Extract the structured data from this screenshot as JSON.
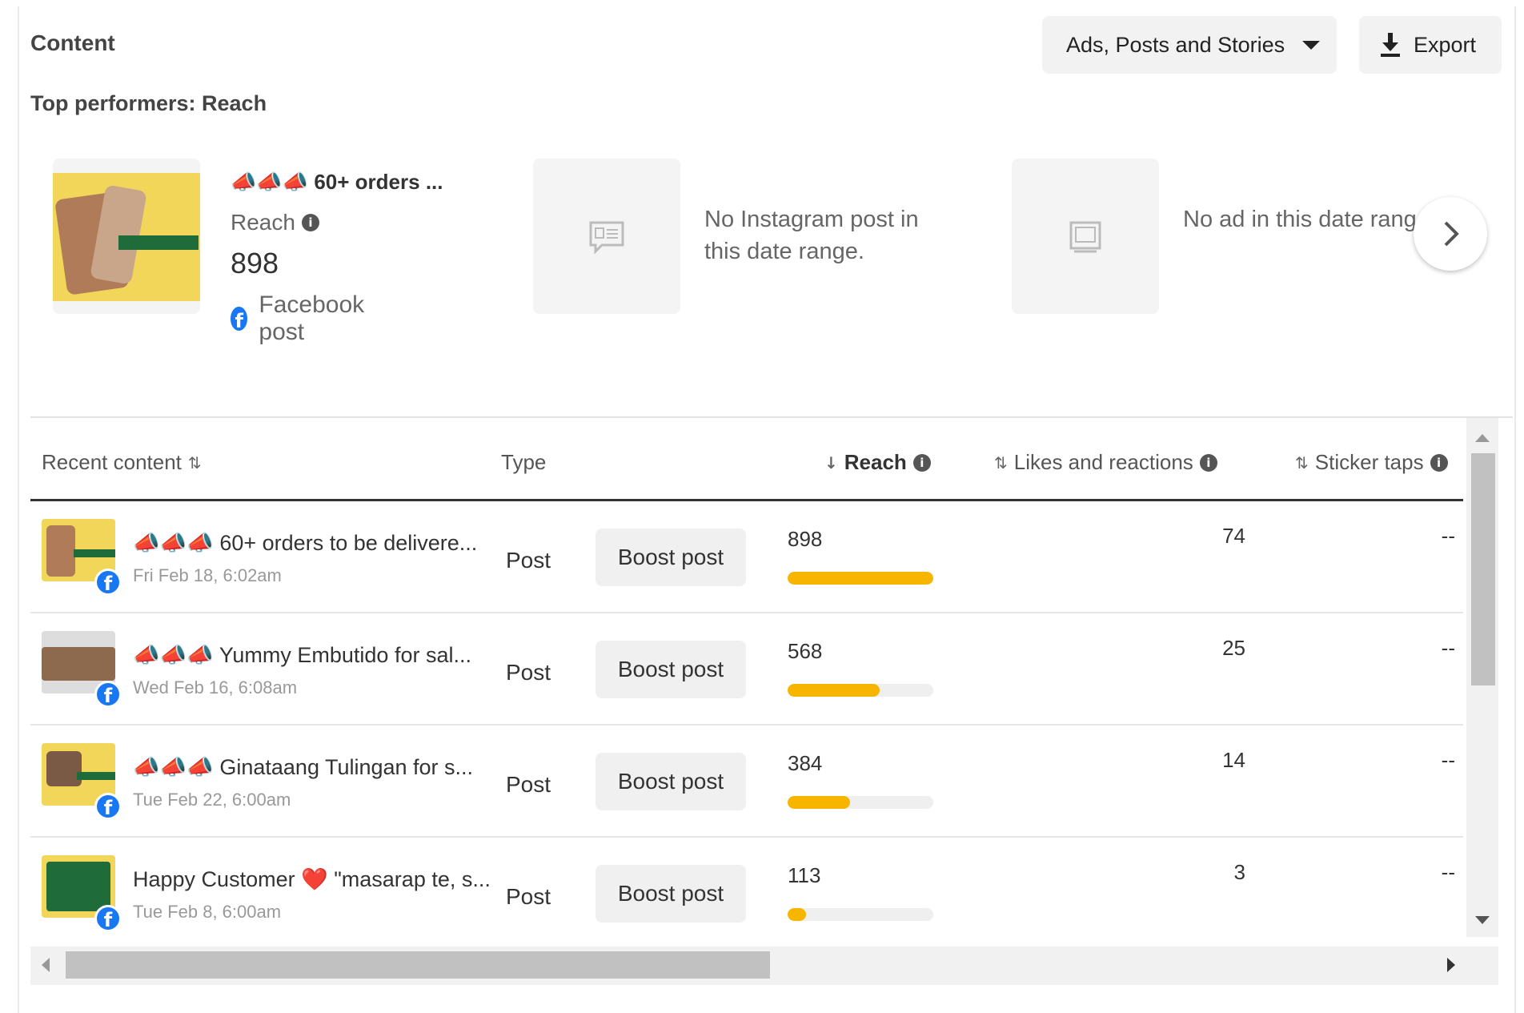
{
  "header": {
    "title": "Content",
    "filter_label": "Ads, Posts and Stories",
    "export_label": "Export"
  },
  "top_performers": {
    "heading": "Top performers: Reach",
    "facebook": {
      "title": "📣📣📣 60+ orders ...",
      "metric_label": "Reach",
      "value": "898",
      "type_label": "Facebook post"
    },
    "instagram": {
      "empty_text": "No Instagram post in this date range."
    },
    "ads": {
      "empty_text": "No ad in this date range."
    }
  },
  "table": {
    "columns": {
      "recent_content": "Recent content",
      "type": "Type",
      "reach": "Reach",
      "likes": "Likes and reactions",
      "sticker": "Sticker taps"
    },
    "boost_label": "Boost post",
    "rows": [
      {
        "title": "📣📣📣 60+ orders to be delivere...",
        "date": "Fri Feb 18, 6:02am",
        "type": "Post",
        "reach": "898",
        "reach_fraction": 1.0,
        "likes": "74",
        "sticker": "--"
      },
      {
        "title": "📣📣📣 Yummy Embutido for sal...",
        "date": "Wed Feb 16, 6:08am",
        "type": "Post",
        "reach": "568",
        "reach_fraction": 0.633,
        "likes": "25",
        "sticker": "--"
      },
      {
        "title": "📣📣📣 Ginataang Tulingan for s...",
        "date": "Tue Feb 22, 6:00am",
        "type": "Post",
        "reach": "384",
        "reach_fraction": 0.428,
        "likes": "14",
        "sticker": "--"
      },
      {
        "title": "Happy Customer ❤️ \"masarap te, s...",
        "date": "Tue Feb 8, 6:00am",
        "type": "Post",
        "reach": "113",
        "reach_fraction": 0.126,
        "likes": "3",
        "sticker": "--"
      }
    ]
  },
  "colors": {
    "bar": "#f7b500",
    "facebook": "#1877f2"
  }
}
